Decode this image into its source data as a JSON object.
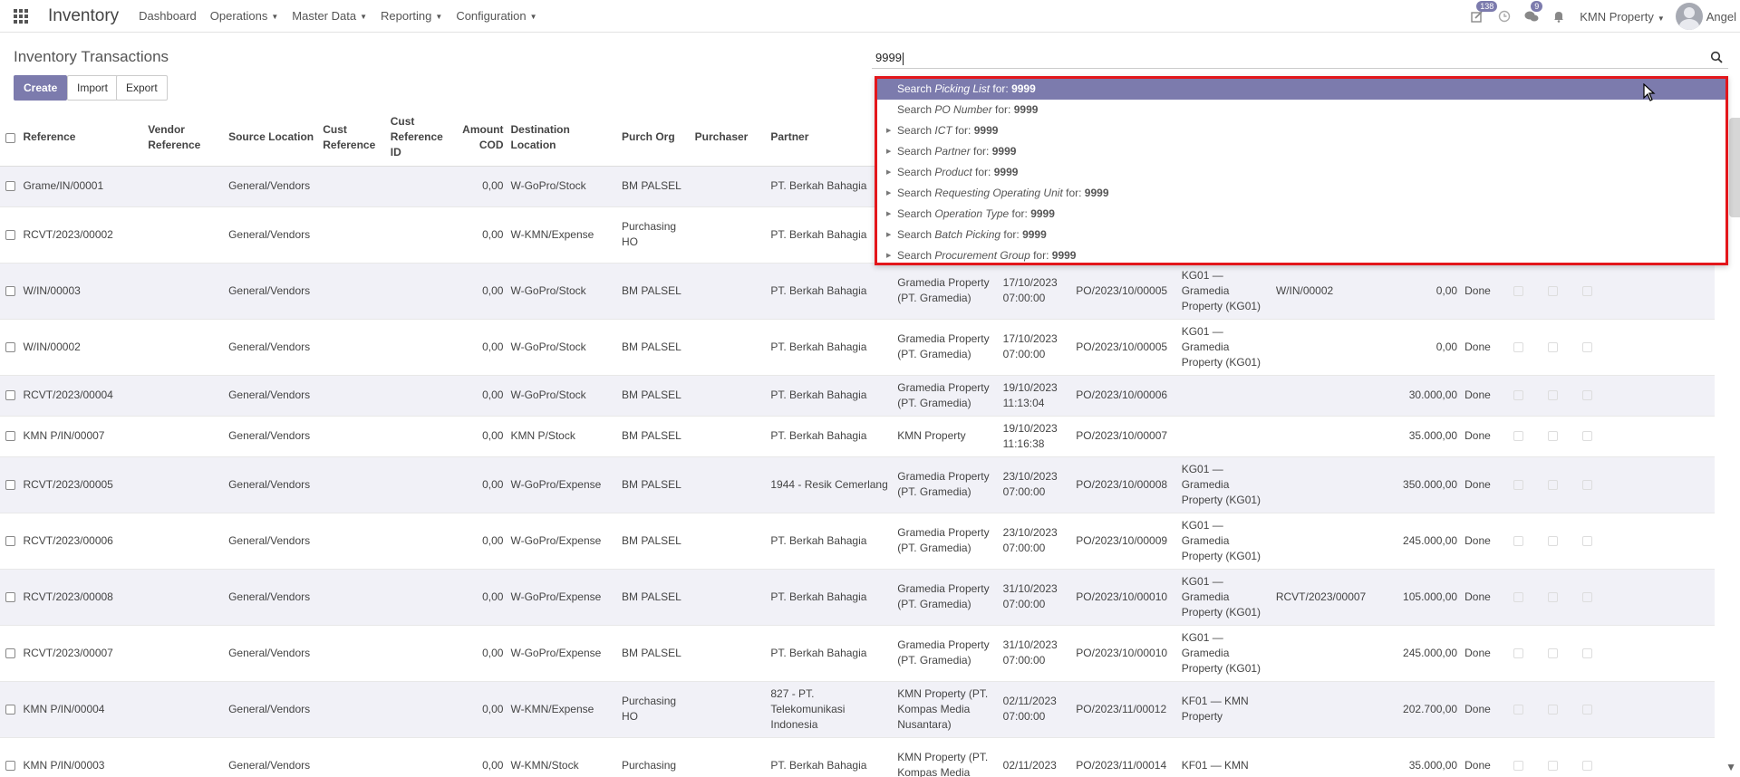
{
  "app": {
    "brand": "Inventory",
    "menu": [
      "Dashboard",
      "Operations",
      "Master Data",
      "Reporting",
      "Configuration"
    ],
    "badges": {
      "activity": "138",
      "messages": "9"
    },
    "company": "KMN Property",
    "user": "Angel"
  },
  "page": {
    "title": "Inventory Transactions",
    "buttons": {
      "create": "Create",
      "import": "Import",
      "export": "Export"
    }
  },
  "search": {
    "value": "9999",
    "suggestions": [
      {
        "prefix": "Search ",
        "field": "Picking List",
        "suffix": " for: ",
        "term": "9999",
        "expandable": false
      },
      {
        "prefix": "Search ",
        "field": "PO Number",
        "suffix": " for: ",
        "term": "9999",
        "expandable": false
      },
      {
        "prefix": "Search ",
        "field": "ICT",
        "suffix": " for: ",
        "term": "9999",
        "expandable": true
      },
      {
        "prefix": "Search ",
        "field": "Partner",
        "suffix": " for: ",
        "term": "9999",
        "expandable": true
      },
      {
        "prefix": "Search ",
        "field": "Product",
        "suffix": " for: ",
        "term": "9999",
        "expandable": true
      },
      {
        "prefix": "Search ",
        "field": "Requesting Operating Unit",
        "suffix": " for: ",
        "term": "9999",
        "expandable": true
      },
      {
        "prefix": "Search ",
        "field": "Operation Type",
        "suffix": " for: ",
        "term": "9999",
        "expandable": true
      },
      {
        "prefix": "Search ",
        "field": "Batch Picking",
        "suffix": " for: ",
        "term": "9999",
        "expandable": true
      },
      {
        "prefix": "Search ",
        "field": "Procurement Group",
        "suffix": " for: ",
        "term": "9999",
        "expandable": true
      }
    ]
  },
  "table": {
    "columns": [
      "Reference",
      "Vendor Reference",
      "Source Location",
      "Cust Reference",
      "Cust Reference ID",
      "Amount COD",
      "Destination Location",
      "Purch Org",
      "Purchaser",
      "Partner"
    ],
    "rows": [
      {
        "ref": "Grame/IN/00001",
        "src": "General/Vendors",
        "cod": "0,00",
        "dest": "W-GoPro/Stock",
        "org": "BM PALSEL",
        "partner": "PT. Berkah Bahagia",
        "company": "",
        "date": "",
        "po": "",
        "unit": "",
        "backorder": "",
        "amount": "",
        "status": ""
      },
      {
        "ref": "RCVT/2023/00002",
        "src": "General/Vendors",
        "cod": "0,00",
        "dest": "W-KMN/Expense",
        "org": "Purchasing HO",
        "partner": "PT. Berkah Bahagia",
        "company": "",
        "date": "",
        "po": "",
        "unit": "",
        "backorder": "",
        "amount": "",
        "status": ""
      },
      {
        "ref": "W/IN/00003",
        "src": "General/Vendors",
        "cod": "0,00",
        "dest": "W-GoPro/Stock",
        "org": "BM PALSEL",
        "partner": "PT. Berkah Bahagia",
        "company": "Gramedia Property (PT. Gramedia)",
        "date": "17/10/2023 07:00:00",
        "po": "PO/2023/10/00005",
        "unit": "KG01 — Gramedia Property (KG01)",
        "backorder": "W/IN/00002",
        "amount": "0,00",
        "status": "Done"
      },
      {
        "ref": "W/IN/00002",
        "src": "General/Vendors",
        "cod": "0,00",
        "dest": "W-GoPro/Stock",
        "org": "BM PALSEL",
        "partner": "PT. Berkah Bahagia",
        "company": "Gramedia Property (PT. Gramedia)",
        "date": "17/10/2023 07:00:00",
        "po": "PO/2023/10/00005",
        "unit": "KG01 — Gramedia Property (KG01)",
        "backorder": "",
        "amount": "0,00",
        "status": "Done"
      },
      {
        "ref": "RCVT/2023/00004",
        "src": "General/Vendors",
        "cod": "0,00",
        "dest": "W-GoPro/Stock",
        "org": "BM PALSEL",
        "partner": "PT. Berkah Bahagia",
        "company": "Gramedia Property (PT. Gramedia)",
        "date": "19/10/2023 11:13:04",
        "po": "PO/2023/10/00006",
        "unit": "",
        "backorder": "",
        "amount": "30.000,00",
        "status": "Done"
      },
      {
        "ref": "KMN P/IN/00007",
        "src": "General/Vendors",
        "cod": "0,00",
        "dest": "KMN P/Stock",
        "org": "BM PALSEL",
        "partner": "PT. Berkah Bahagia",
        "company": "KMN Property",
        "date": "19/10/2023 11:16:38",
        "po": "PO/2023/10/00007",
        "unit": "",
        "backorder": "",
        "amount": "35.000,00",
        "status": "Done"
      },
      {
        "ref": "RCVT/2023/00005",
        "src": "General/Vendors",
        "cod": "0,00",
        "dest": "W-GoPro/Expense",
        "org": "BM PALSEL",
        "partner": "1944 - Resik Cemerlang",
        "company": "Gramedia Property (PT. Gramedia)",
        "date": "23/10/2023 07:00:00",
        "po": "PO/2023/10/00008",
        "unit": "KG01 — Gramedia Property (KG01)",
        "backorder": "",
        "amount": "350.000,00",
        "status": "Done"
      },
      {
        "ref": "RCVT/2023/00006",
        "src": "General/Vendors",
        "cod": "0,00",
        "dest": "W-GoPro/Expense",
        "org": "BM PALSEL",
        "partner": "PT. Berkah Bahagia",
        "company": "Gramedia Property (PT. Gramedia)",
        "date": "23/10/2023 07:00:00",
        "po": "PO/2023/10/00009",
        "unit": "KG01 — Gramedia Property (KG01)",
        "backorder": "",
        "amount": "245.000,00",
        "status": "Done"
      },
      {
        "ref": "RCVT/2023/00008",
        "src": "General/Vendors",
        "cod": "0,00",
        "dest": "W-GoPro/Expense",
        "org": "BM PALSEL",
        "partner": "PT. Berkah Bahagia",
        "company": "Gramedia Property (PT. Gramedia)",
        "date": "31/10/2023 07:00:00",
        "po": "PO/2023/10/00010",
        "unit": "KG01 — Gramedia Property (KG01)",
        "backorder": "RCVT/2023/00007",
        "amount": "105.000,00",
        "status": "Done"
      },
      {
        "ref": "RCVT/2023/00007",
        "src": "General/Vendors",
        "cod": "0,00",
        "dest": "W-GoPro/Expense",
        "org": "BM PALSEL",
        "partner": "PT. Berkah Bahagia",
        "company": "Gramedia Property (PT. Gramedia)",
        "date": "31/10/2023 07:00:00",
        "po": "PO/2023/10/00010",
        "unit": "KG01 — Gramedia Property (KG01)",
        "backorder": "",
        "amount": "245.000,00",
        "status": "Done"
      },
      {
        "ref": "KMN P/IN/00004",
        "src": "General/Vendors",
        "cod": "0,00",
        "dest": "W-KMN/Expense",
        "org": "Purchasing HO",
        "partner": "827 - PT. Telekomunikasi Indonesia",
        "company": "KMN Property (PT. Kompas Media Nusantara)",
        "date": "02/11/2023 07:00:00",
        "po": "PO/2023/11/00012",
        "unit": "KF01 — KMN Property",
        "backorder": "",
        "amount": "202.700,00",
        "status": "Done"
      },
      {
        "ref": "KMN P/IN/00003",
        "src": "General/Vendors",
        "cod": "0,00",
        "dest": "W-KMN/Stock",
        "org": "Purchasing",
        "partner": "PT. Berkah Bahagia",
        "company": "KMN Property (PT. Kompas Media",
        "date": "02/11/2023",
        "po": "PO/2023/11/00014",
        "unit": "KF01 — KMN",
        "backorder": "",
        "amount": "35.000,00",
        "status": "Done"
      }
    ]
  }
}
